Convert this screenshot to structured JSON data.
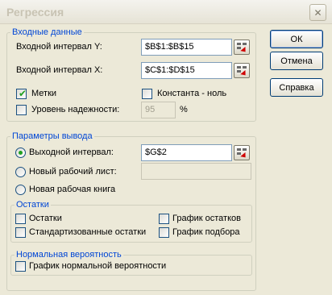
{
  "window": {
    "title": "Регрессия",
    "close_symbol": "✕"
  },
  "input_group": {
    "legend": "Входные данные",
    "y_range_label": "Входной интервал Y:",
    "y_range_value": "$B$1:$B$15",
    "x_range_label": "Входной интервал X:",
    "x_range_value": "$C$1:$D$15",
    "labels_label": "Метки",
    "labels_checked": true,
    "constant_zero_label": "Константа - ноль",
    "constant_zero_checked": false,
    "confidence_label": "Уровень надежности:",
    "confidence_checked": false,
    "confidence_value": "95",
    "percent_sign": "%"
  },
  "output_group": {
    "legend": "Параметры вывода",
    "output_range_label": "Выходной интервал:",
    "output_range_value": "$G$2",
    "new_sheet_label": "Новый рабочий лист:",
    "new_sheet_value": "",
    "new_book_label": "Новая рабочая книга",
    "selected_option": "output_range"
  },
  "residuals_group": {
    "legend": "Остатки",
    "residuals_label": "Остатки",
    "standardized_label": "Стандартизованные остатки",
    "residual_plots_label": "График остатков",
    "line_fit_label": "График подбора"
  },
  "normal_group": {
    "legend": "Нормальная вероятность",
    "normal_plot_label": "График нормальной вероятности"
  },
  "buttons": {
    "ok": "ОК",
    "cancel": "Отмена",
    "help": "Справка"
  }
}
